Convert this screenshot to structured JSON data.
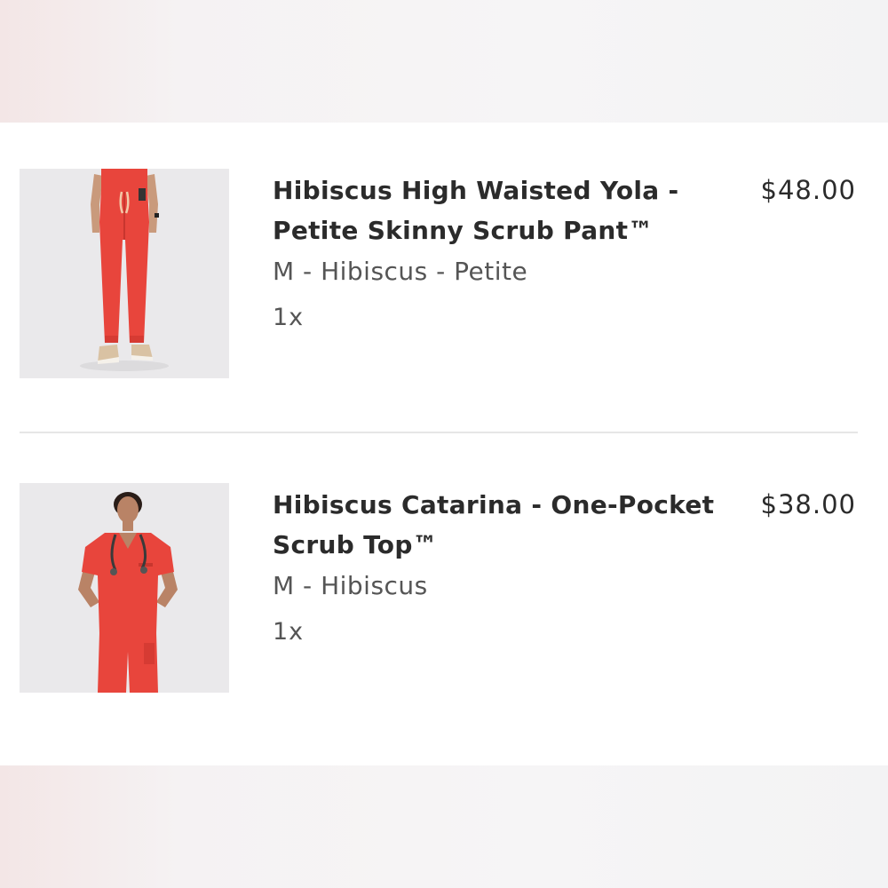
{
  "cart": {
    "items": [
      {
        "name": "Hibiscus High Waisted Yola - Petite Skinny Scrub Pant™",
        "variant": "M - Hibiscus - Petite",
        "quantity": "1x",
        "price": "$48.00",
        "image_icon": "scrub-pants-photo-icon"
      },
      {
        "name": "Hibiscus Catarina - One-Pocket Scrub Top™",
        "variant": "M - Hibiscus",
        "quantity": "1x",
        "price": "$38.00",
        "image_icon": "scrub-top-photo-icon"
      }
    ]
  },
  "colors": {
    "product": "#e8453c",
    "text": "#2b2b2b",
    "muted": "#555555"
  }
}
